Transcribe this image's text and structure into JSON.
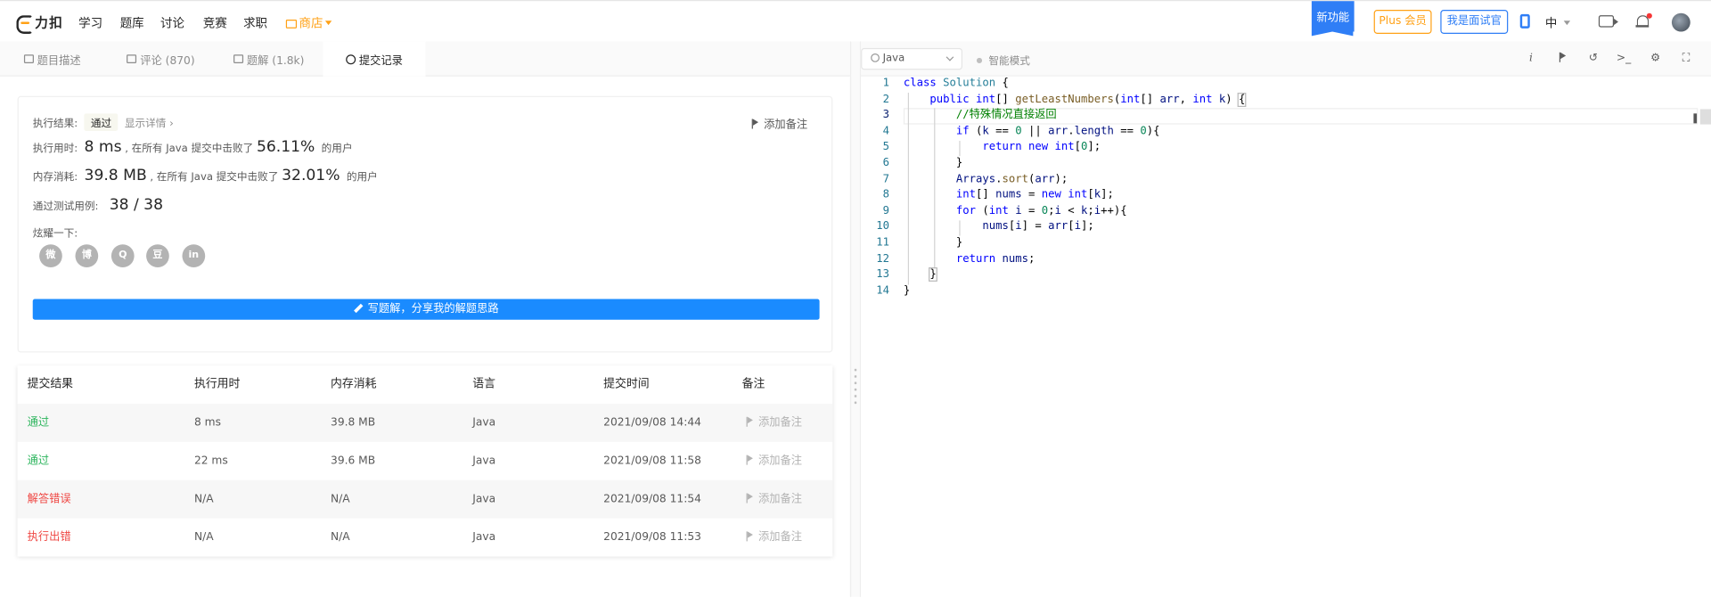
{
  "nav": {
    "logo_text": "力扣",
    "links": [
      "学习",
      "题库",
      "讨论",
      "竞赛",
      "求职"
    ],
    "shop_label": "商店",
    "new_feature": "新功能",
    "plus_label": "Plus 会员",
    "interviewer_label": "我是面试官",
    "lang_label": "中"
  },
  "tabs": [
    {
      "label": "题目描述"
    },
    {
      "label": "评论 (870)"
    },
    {
      "label": "题解 (1.8k)"
    },
    {
      "label": "提交记录"
    }
  ],
  "result": {
    "status_label": "执行结果:",
    "status": "通过",
    "detail_link": "显示详情 ›",
    "add_note": "添加备注",
    "time_label": "执行用时:",
    "time_value": "8 ms",
    "time_mid": ", 在所有 Java 提交中击败了",
    "time_pct": "56.11%",
    "time_suffix": "的用户",
    "mem_label": "内存消耗:",
    "mem_value": "39.8 MB",
    "mem_mid": ", 在所有 Java 提交中击败了",
    "mem_pct": "32.01%",
    "mem_suffix": "的用户",
    "cases_label": "通过测试用例:",
    "cases_value": "38 / 38",
    "share_label": "炫耀一下:",
    "share_icons": [
      "wechat-icon",
      "weibo-icon",
      "qq-icon",
      "douban-icon",
      "linkedin-icon"
    ],
    "write_solution": "写题解，分享我的解题思路"
  },
  "table": {
    "headers": [
      "提交结果",
      "执行用时",
      "内存消耗",
      "语言",
      "提交时间",
      "备注"
    ],
    "rows": [
      {
        "status": "通过",
        "status_type": "ok",
        "time": "8 ms",
        "memory": "39.8 MB",
        "lang": "Java",
        "submitted": "2021/09/08 14:44",
        "note": "添加备注"
      },
      {
        "status": "通过",
        "status_type": "ok",
        "time": "22 ms",
        "memory": "39.6 MB",
        "lang": "Java",
        "submitted": "2021/09/08 11:58",
        "note": "添加备注"
      },
      {
        "status": "解答错误",
        "status_type": "err",
        "time": "N/A",
        "memory": "N/A",
        "lang": "Java",
        "submitted": "2021/09/08 11:54",
        "note": "添加备注"
      },
      {
        "status": "执行出错",
        "status_type": "err",
        "time": "N/A",
        "memory": "N/A",
        "lang": "Java",
        "submitted": "2021/09/08 11:53",
        "note": "添加备注"
      }
    ]
  },
  "editor": {
    "language": "Java",
    "smart_mode": "智能模式",
    "toolbar_icons": [
      "info-icon",
      "flag-icon",
      "reset-icon",
      "console-icon",
      "settings-icon",
      "fullscreen-icon"
    ],
    "lines": [
      "class Solution {",
      "    public int[] getLeastNumbers(int[] arr, int k) {",
      "        //特殊情况直接返回",
      "        if (k == 0 || arr.length == 0){",
      "            return new int[0];",
      "        }",
      "        Arrays.sort(arr);",
      "        int[] nums = new int[k];",
      "        for (int i = 0;i < k;i++){",
      "            nums[i] = arr[i];",
      "        }",
      "        return nums;",
      "    }",
      "}"
    ]
  }
}
